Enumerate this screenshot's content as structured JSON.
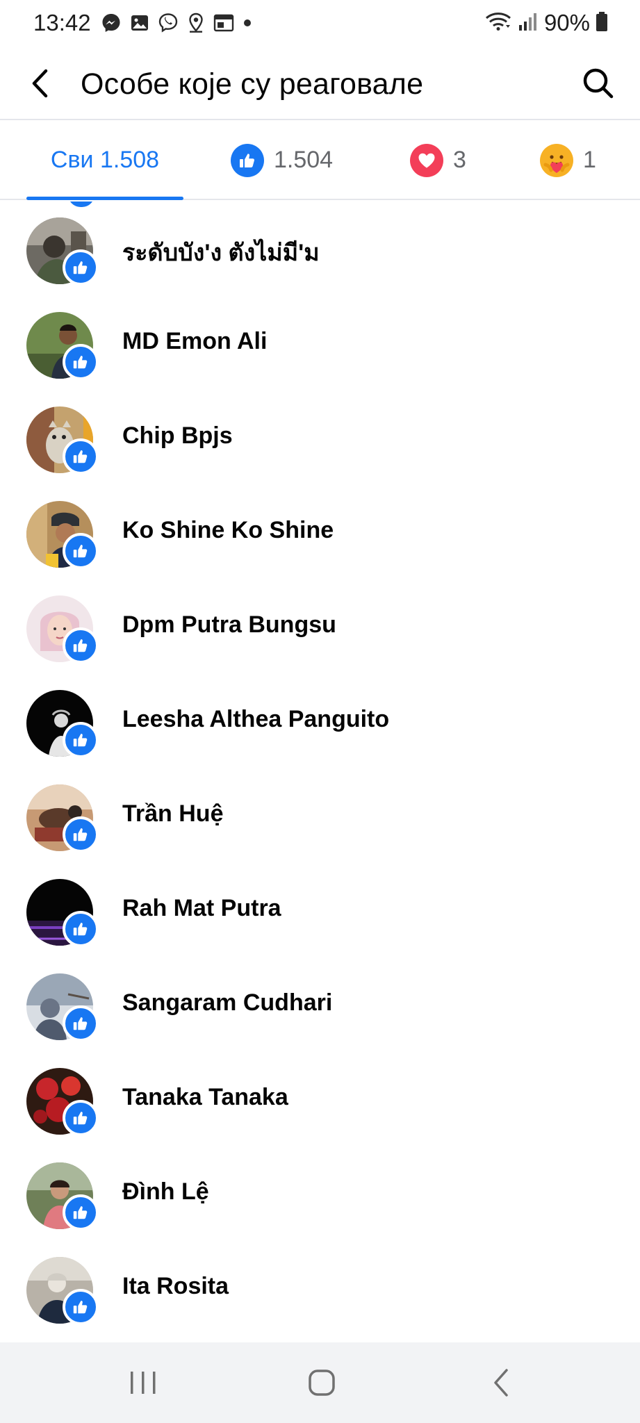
{
  "status_bar": {
    "time": "13:42",
    "battery": "90%",
    "icons": [
      "messenger-icon",
      "gallery-icon",
      "viber-icon",
      "location-icon",
      "calendar-icon",
      "dot-icon",
      "wifi-icon",
      "signal-icon",
      "battery-icon"
    ]
  },
  "header": {
    "title": "Особе које су реаговале",
    "back_icon": "back-arrow-icon",
    "search_icon": "search-icon"
  },
  "tabs": [
    {
      "label": "Сви 1.508",
      "active": true
    },
    {
      "icon": "like-icon",
      "count": "1.504",
      "color": "#1877f2"
    },
    {
      "icon": "love-icon",
      "count": "3",
      "color": "#f33e58"
    },
    {
      "icon": "care-icon",
      "count": "1",
      "color": "#f7b125"
    }
  ],
  "people": [
    {
      "name": "ระดับบัง'ง ตังไม่มี'ม",
      "reaction": "like"
    },
    {
      "name": "MD Emon Ali",
      "reaction": "like"
    },
    {
      "name": "Chip Bpjs",
      "reaction": "like"
    },
    {
      "name": "Ko Shine Ko Shine",
      "reaction": "like"
    },
    {
      "name": "Dpm Putra Bungsu",
      "reaction": "like"
    },
    {
      "name": "Leesha Althea Panguito",
      "reaction": "like"
    },
    {
      "name": "Trần Huệ",
      "reaction": "like"
    },
    {
      "name": "Rah Mat Putra",
      "reaction": "like"
    },
    {
      "name": "Sangaram Cudhari",
      "reaction": "like"
    },
    {
      "name": "Tanaka Tanaka",
      "reaction": "like"
    },
    {
      "name": "Đình Lệ",
      "reaction": "like"
    },
    {
      "name": "Ita Rosita",
      "reaction": "like"
    }
  ],
  "nav_bar": {
    "icons": [
      "recent-apps-icon",
      "home-icon",
      "back-icon"
    ]
  },
  "colors": {
    "accent": "#1877f2",
    "love": "#f33e58",
    "care": "#f7b125",
    "text": "#050505",
    "secondary_text": "#65676b",
    "divider": "#e4e6eb",
    "nav_bar_bg": "#f2f3f5"
  }
}
